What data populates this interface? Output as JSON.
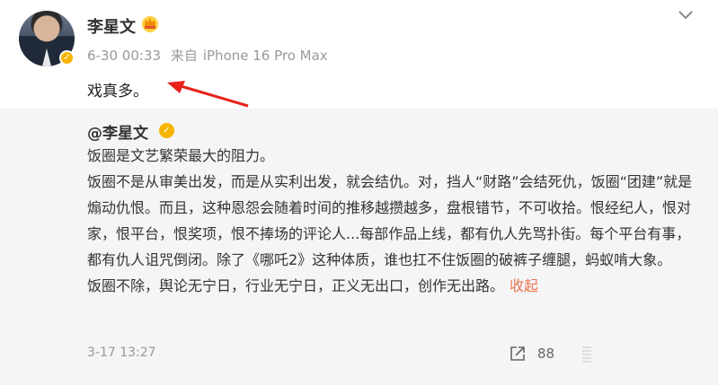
{
  "post": {
    "author": "李星文",
    "date": "6-30 00:33",
    "source_prefix": "来自",
    "device": "iPhone 16 Pro Max",
    "text": "戏真多。"
  },
  "repost": {
    "author": "@李星文",
    "paragraphs": [
      "饭圈是文艺繁荣最大的阻力。",
      "饭圈不是从审美出发，而是从实利出发，就会结仇。对，挡人“财路”会结死仇，饭圈“团建”就是煽动仇恨。而且，这种恩怨会随着时间的推移越攒越多，盘根错节，不可收拾。恨经纪人，恨对家，恨平台，恨奖项，恨不捧场的评论人...每部作品上线，都有仇人先骂扑街。每个平台有事，都有仇人诅咒倒闭。除了《哪吒2》这种体质，谁也扛不住饭圈的破裤子缠腿，蚂蚁啃大象。"
    ],
    "last_line": "饭圈不除，舆论无宁日，行业无宁日，正义无出口，创作无出路。",
    "collapse_label": "收起",
    "time": "3-17 13:27",
    "share_count": "88"
  },
  "icons": {
    "crown": "crown-icon",
    "verified": "verified-icon",
    "more": "chevron-down-icon",
    "share": "share-icon",
    "arrow": "red-arrow-annotation"
  },
  "colors": {
    "verified": "#f7b500",
    "link": "#eb7350",
    "arrow": "#e8221b",
    "repost_bg": "#f5f5f5"
  }
}
